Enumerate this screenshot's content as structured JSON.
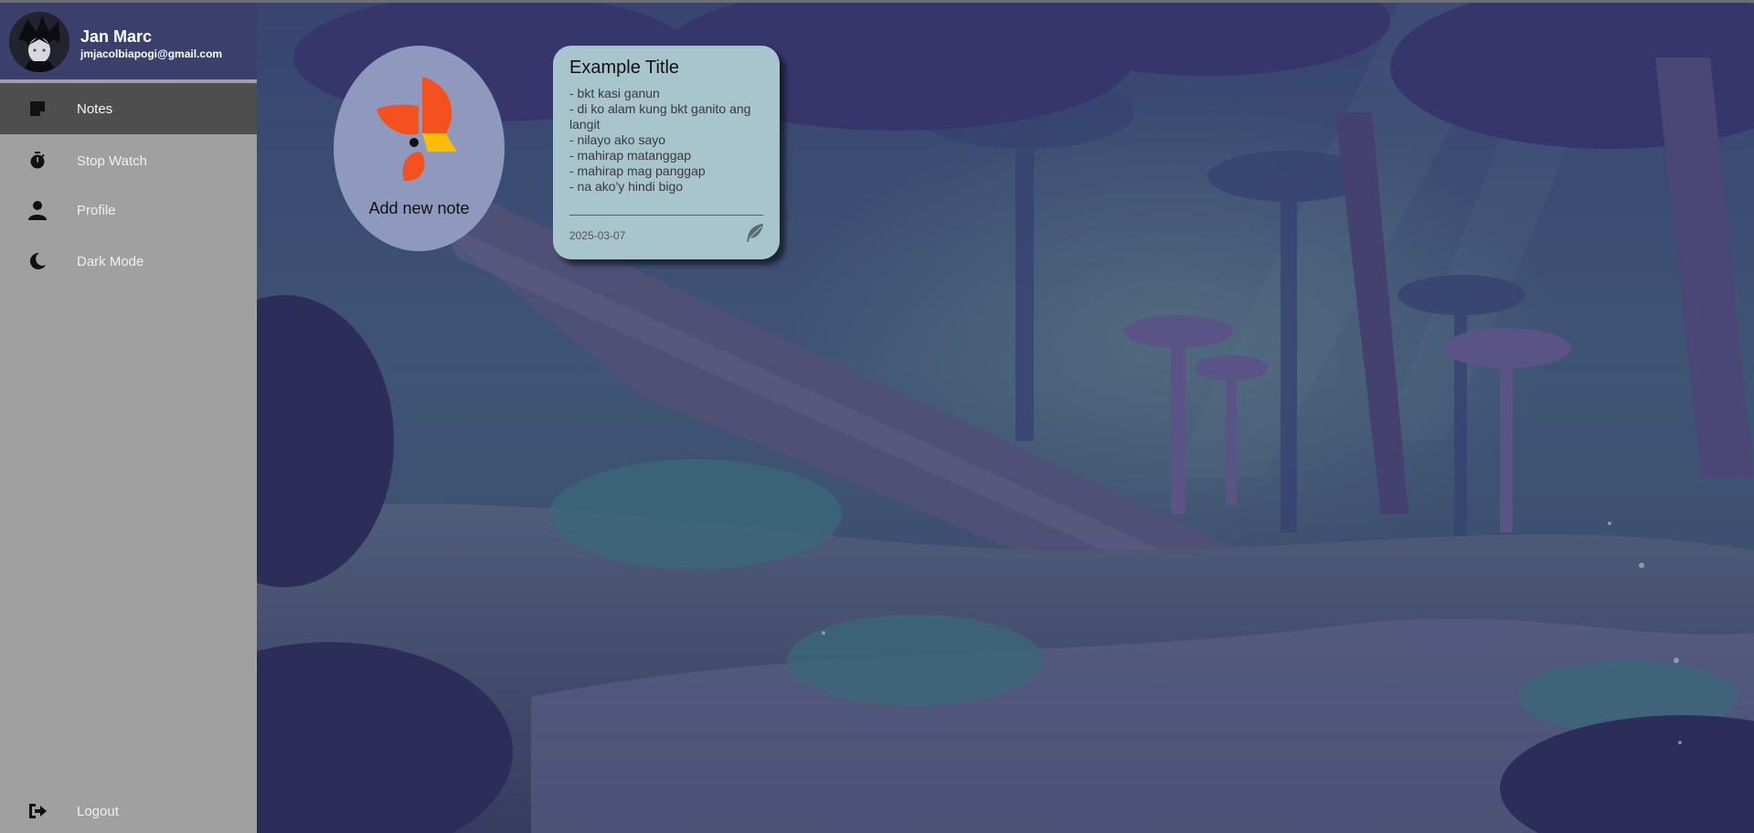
{
  "user": {
    "name": "Jan Marc",
    "email": "jmjacolbiapogi@gmail.com"
  },
  "sidebar": {
    "items": [
      {
        "label": "Notes",
        "icon": "note-icon",
        "active": true
      },
      {
        "label": "Stop Watch",
        "icon": "stopwatch-icon",
        "active": false
      },
      {
        "label": "Profile",
        "icon": "person-icon",
        "active": false
      },
      {
        "label": "Dark Mode",
        "icon": "moon-icon",
        "active": false
      }
    ],
    "logout_label": "Logout"
  },
  "main": {
    "add_note_label": "Add new note",
    "notes": [
      {
        "title": "Example Title",
        "lines": [
          "- bkt kasi ganun",
          "- di ko alam kung bkt ganito ang langit",
          "- nilayo ako sayo",
          "- mahirap matanggap",
          "- mahirap mag panggap",
          "- na ako'y hindi bigo"
        ],
        "date": "2025-03-07"
      }
    ]
  },
  "colors": {
    "sidebar_bg": "#a0a0a0",
    "profile_bg": "#3b3f6b",
    "active_item_bg": "#4e4e4e",
    "note_card_bg": "#a8c4cc",
    "add_note_bg": "#8e99bd",
    "logo_orange": "#f4511e",
    "logo_yellow": "#fbbc05"
  }
}
